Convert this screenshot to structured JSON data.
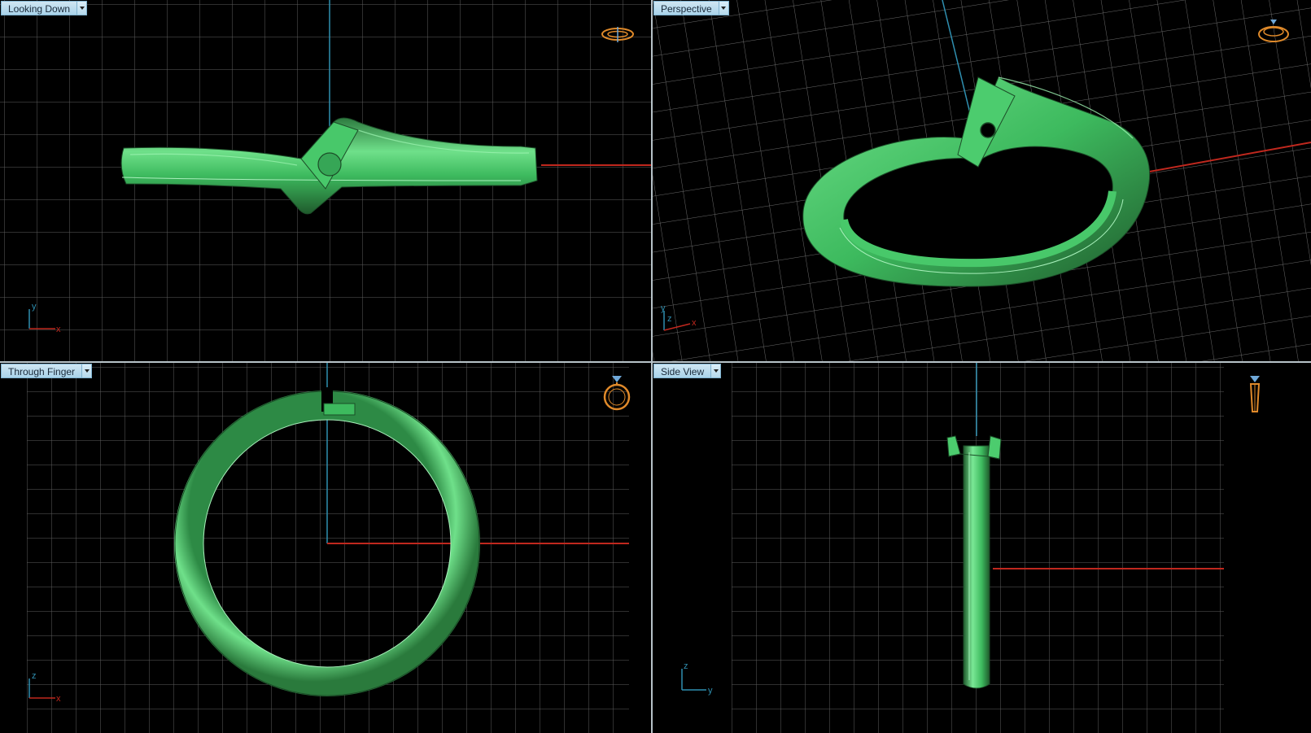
{
  "viewports": [
    {
      "id": "top-left",
      "label": "Looking Down",
      "axis_v": "y",
      "axis_h": "x"
    },
    {
      "id": "top-right",
      "label": "Perspective",
      "axis_v": "y",
      "axis_z": "z",
      "axis_h": "x"
    },
    {
      "id": "bottom-left",
      "label": "Through Finger",
      "axis_v": "z",
      "axis_h": "x"
    },
    {
      "id": "bottom-right",
      "label": "Side View",
      "axis_v": "z",
      "axis_h": "y"
    }
  ],
  "colors": {
    "ring_green": "#3dba5e",
    "grid_line": "#6f6f6f",
    "x_axis": "#c0281e",
    "y_axis": "#2f8fb0",
    "nav_icon": "#e08a2a"
  }
}
